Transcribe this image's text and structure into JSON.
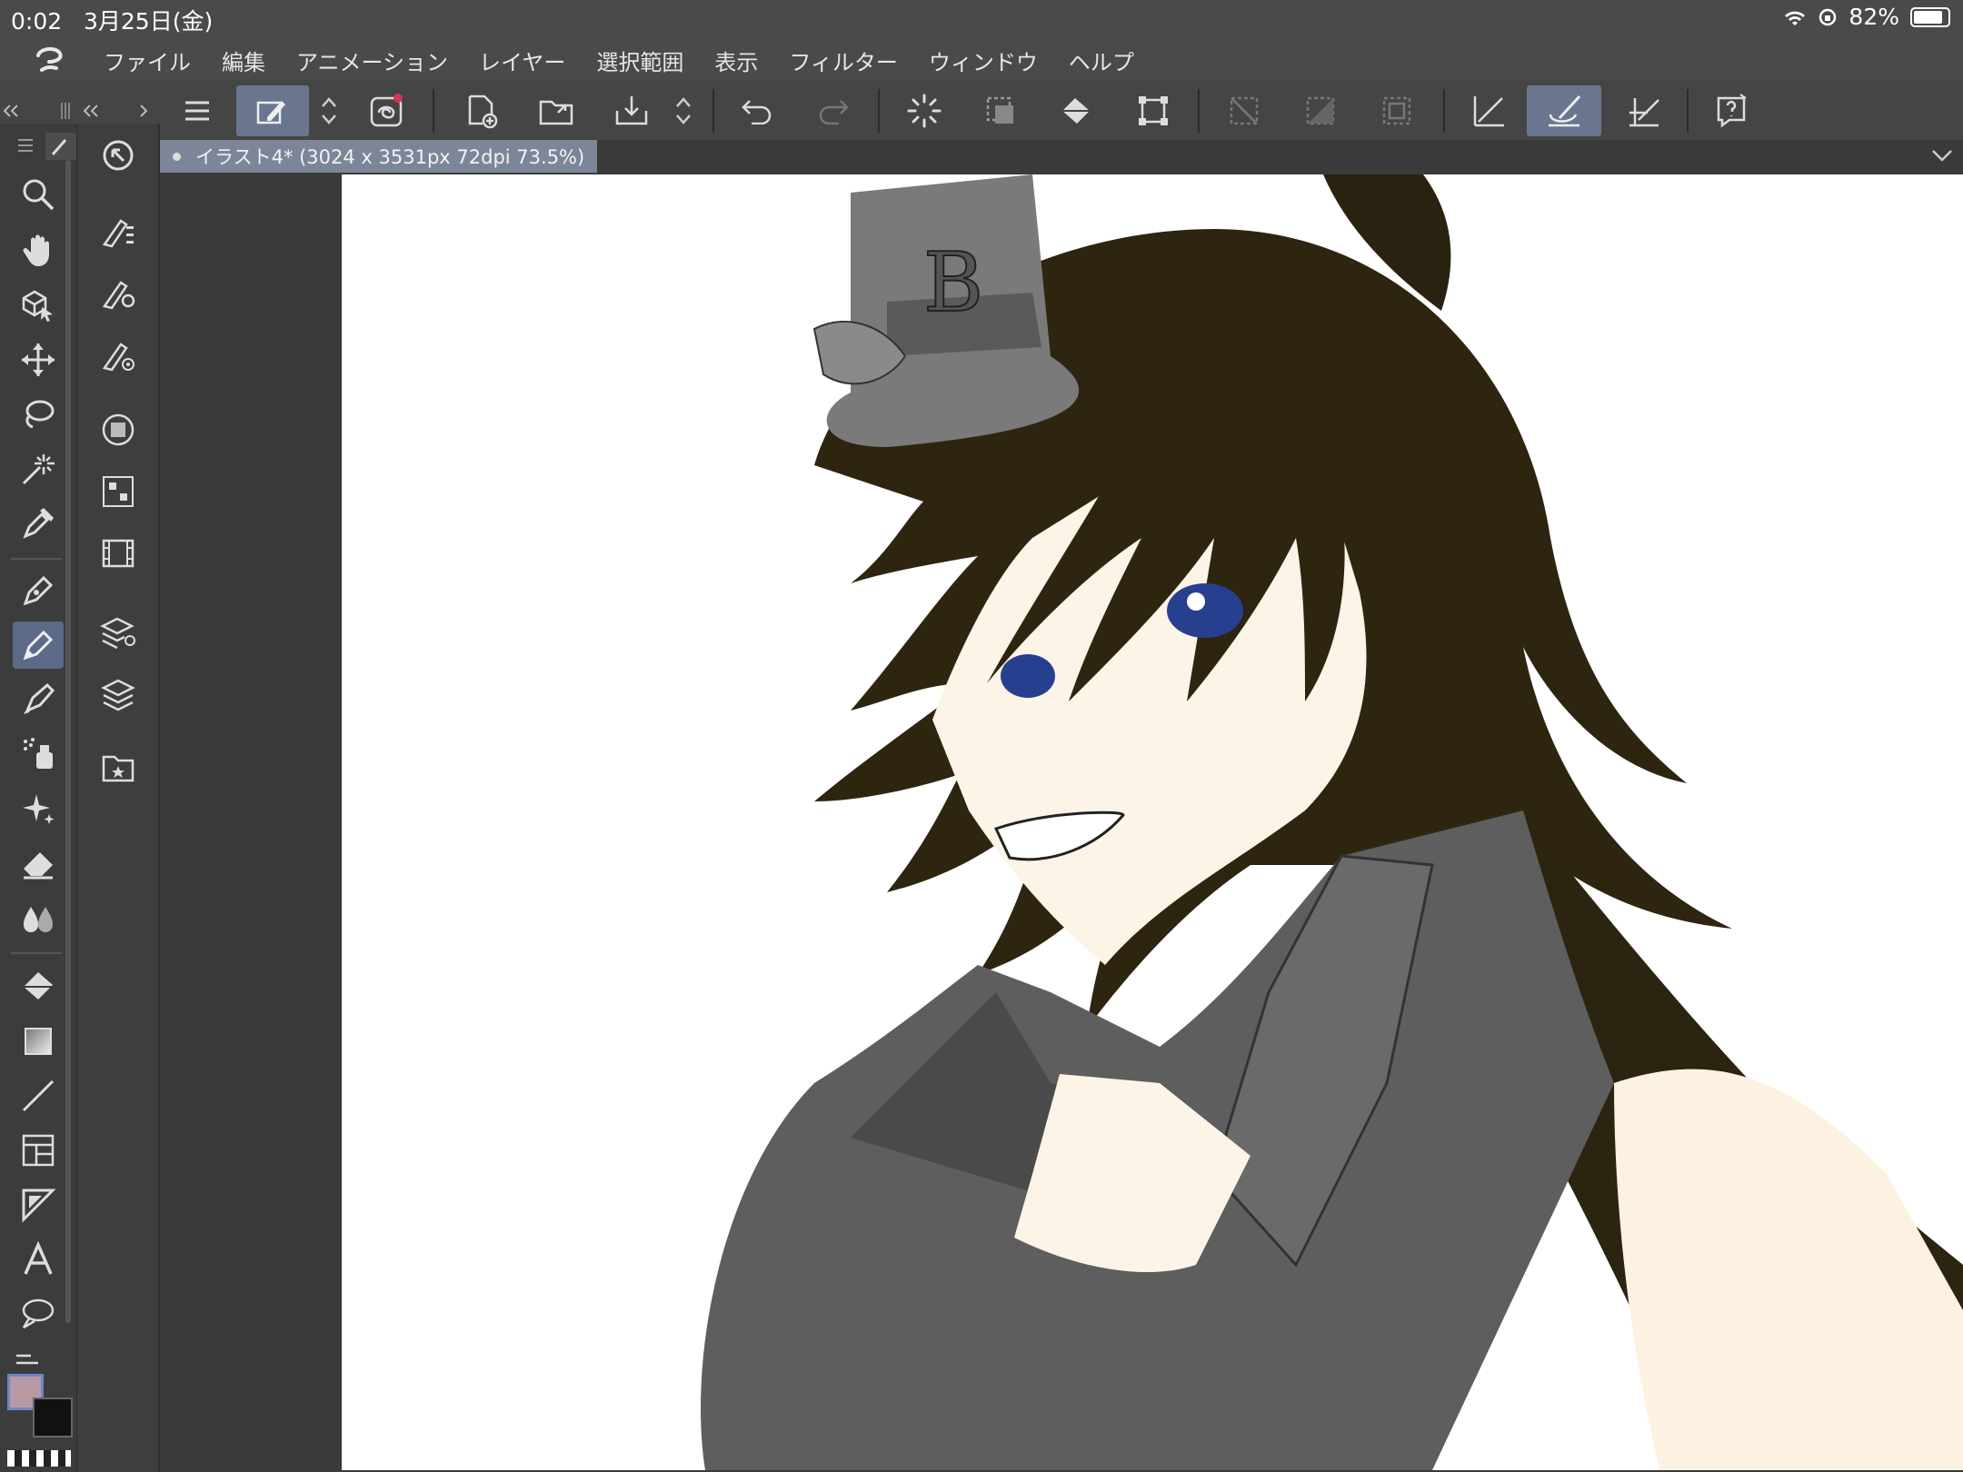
{
  "status": {
    "time": "0:02",
    "date": "3月25日(金)",
    "battery": "82%",
    "battery_level": 0.82
  },
  "menu": {
    "items": [
      "ファイル",
      "編集",
      "アニメーション",
      "レイヤー",
      "選択範囲",
      "表示",
      "フィルター",
      "ウィンドウ",
      "ヘルプ"
    ]
  },
  "document": {
    "tab_label": "イラスト4* (3024 x 3531px 72dpi 73.5%)"
  },
  "colors": {
    "main": "#b79aa4",
    "sub": "#111111",
    "accent": "#6a7690"
  },
  "tools": [
    "zoom-icon",
    "hand-icon",
    "object-icon",
    "move-icon",
    "lasso-select-icon",
    "magic-wand-icon",
    "eyedropper-icon",
    "pen-icon",
    "pencil-icon",
    "brush-icon",
    "airbrush-icon",
    "decoration-icon",
    "eraser-icon",
    "blend-icon",
    "fill-icon",
    "gradient-icon",
    "line-icon",
    "frame-icon",
    "ruler-icon",
    "text-icon",
    "balloon-icon"
  ]
}
